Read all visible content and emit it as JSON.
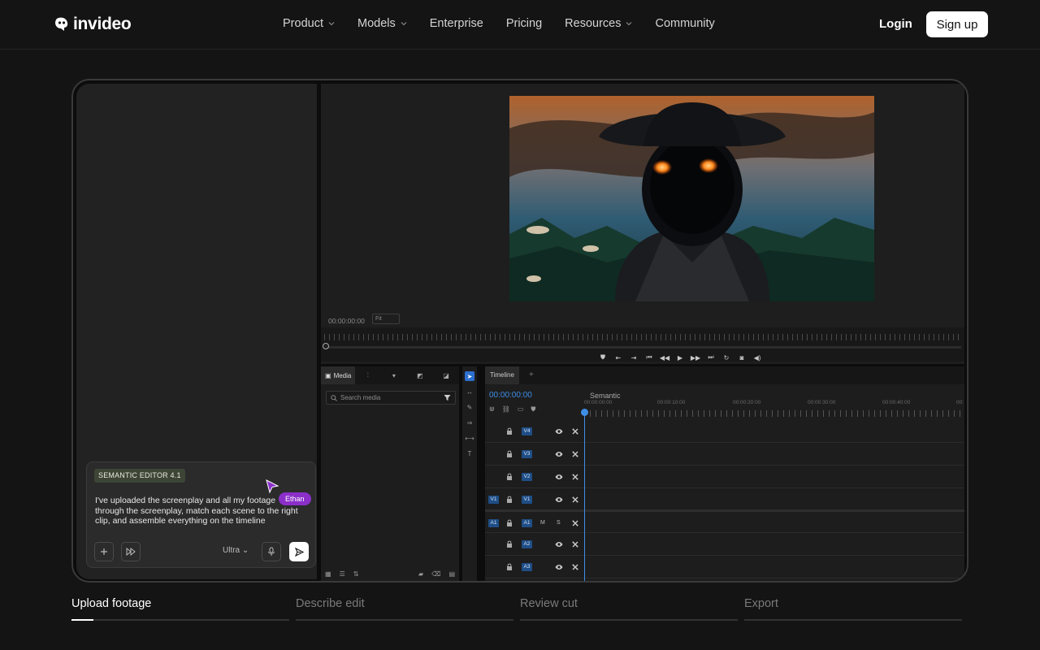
{
  "nav": {
    "brand": "invideo",
    "menu": [
      {
        "label": "Product",
        "has_dropdown": true
      },
      {
        "label": "Models",
        "has_dropdown": true
      },
      {
        "label": "Enterprise",
        "has_dropdown": false
      },
      {
        "label": "Pricing",
        "has_dropdown": false
      },
      {
        "label": "Resources",
        "has_dropdown": true
      },
      {
        "label": "Community",
        "has_dropdown": false
      }
    ],
    "login": "Login",
    "signup": "Sign up"
  },
  "chat": {
    "badge": "SEMANTIC EDITOR 4.1",
    "message_lines": [
      "I've uploaded the screenplay and all my footage",
      "through the screenplay, match each scene to the right",
      "clip, and assemble everything on the timeline"
    ],
    "cursor_user": "Ethan",
    "mode": "Ultra",
    "icons": [
      "plus-icon",
      "fast-forward-icon",
      "chevron-down-icon",
      "microphone-icon",
      "send-icon"
    ]
  },
  "preview": {
    "timecode": "00:00:00:00",
    "fit": "Fit"
  },
  "media": {
    "tab_label": "Media",
    "search_placeholder": "Search media"
  },
  "timeline": {
    "tab_label": "Timeline",
    "add_tab": "+",
    "timecode": "00:00:00:00",
    "sequence_name": "Semantic",
    "ruler_labels": [
      "00:00:00:00",
      "00:00:10:00",
      "00:00:20:00",
      "00:00:30:00",
      "00:00:40:00",
      "00:"
    ],
    "tracks": [
      {
        "src": "",
        "name": "V4",
        "m": "",
        "s": ""
      },
      {
        "src": "",
        "name": "V3",
        "m": "",
        "s": ""
      },
      {
        "src": "",
        "name": "V2",
        "m": "",
        "s": ""
      },
      {
        "src": "V1",
        "name": "V1",
        "m": "",
        "s": ""
      },
      {
        "src": "A1",
        "name": "A1",
        "m": "M",
        "s": "S"
      },
      {
        "src": "",
        "name": "A2",
        "m": "",
        "s": ""
      },
      {
        "src": "",
        "name": "A3",
        "m": "",
        "s": ""
      }
    ]
  },
  "steps": [
    {
      "label": "Upload footage",
      "active": true,
      "progress": 0.1
    },
    {
      "label": "Describe edit",
      "active": false,
      "progress": 0
    },
    {
      "label": "Review cut",
      "active": false,
      "progress": 0
    },
    {
      "label": "Export",
      "active": false,
      "progress": 0
    }
  ],
  "colors": {
    "accent": "#3f8ee6",
    "cursor_badge": "#8b2fc9",
    "badge_bg": "#3d4536"
  }
}
